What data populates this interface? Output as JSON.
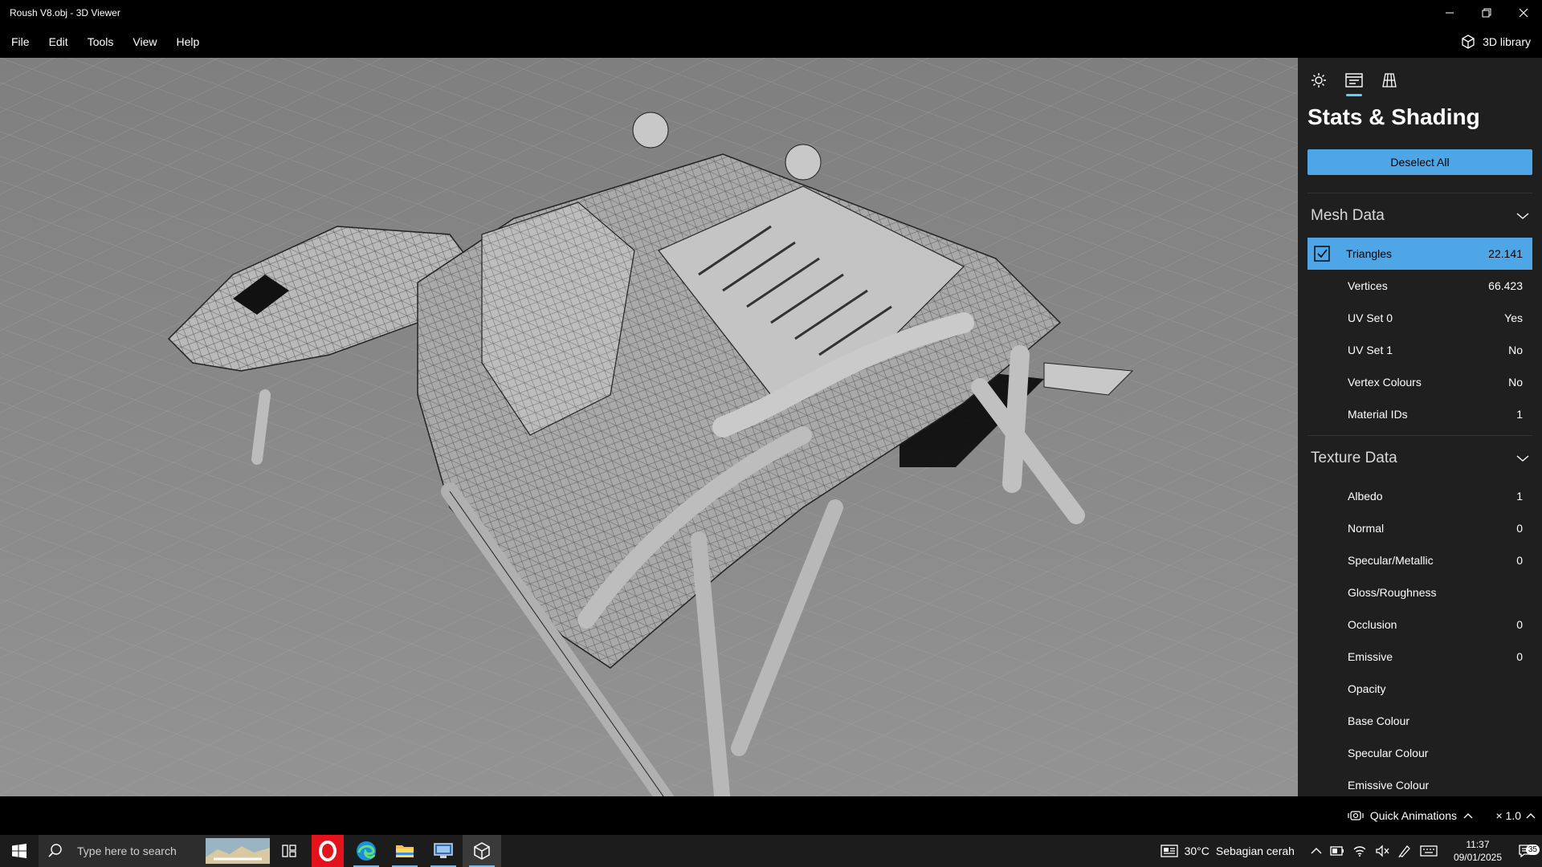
{
  "window": {
    "title": "Roush V8.obj - 3D Viewer"
  },
  "menu": {
    "items": [
      "File",
      "Edit",
      "Tools",
      "View",
      "Help"
    ],
    "library_label": "3D library"
  },
  "panel": {
    "title": "Stats & Shading",
    "deselect_label": "Deselect All",
    "mesh": {
      "heading": "Mesh Data",
      "rows": [
        {
          "name": "Triangles",
          "value": "22.141"
        },
        {
          "name": "Vertices",
          "value": "66.423"
        },
        {
          "name": "UV Set 0",
          "value": "Yes"
        },
        {
          "name": "UV Set 1",
          "value": "No"
        },
        {
          "name": "Vertex Colours",
          "value": "No"
        },
        {
          "name": "Material IDs",
          "value": "1"
        }
      ]
    },
    "texture": {
      "heading": "Texture Data",
      "rows": [
        {
          "name": "Albedo",
          "value": "1"
        },
        {
          "name": "Normal",
          "value": "0"
        },
        {
          "name": "Specular/Metallic",
          "value": "0"
        },
        {
          "name": "Gloss/Roughness",
          "value": ""
        },
        {
          "name": "Occlusion",
          "value": "0"
        },
        {
          "name": "Emissive",
          "value": "0"
        },
        {
          "name": "Opacity",
          "value": ""
        },
        {
          "name": "Base Colour",
          "value": ""
        },
        {
          "name": "Specular Colour",
          "value": ""
        },
        {
          "name": "Emissive Colour",
          "value": ""
        }
      ]
    }
  },
  "bottom": {
    "quick_animations": "Quick Animations",
    "speed": "× 1.0"
  },
  "taskbar": {
    "search_placeholder": "Type here to search",
    "weather": {
      "temp": "30°C",
      "desc": "Sebagian cerah"
    },
    "time": "11:37",
    "date": "09/01/2025",
    "notifications": "35"
  },
  "colors": {
    "accent": "#4fa6e6",
    "panel": "#1f1f1f",
    "viewport": "#8d8d8d"
  }
}
